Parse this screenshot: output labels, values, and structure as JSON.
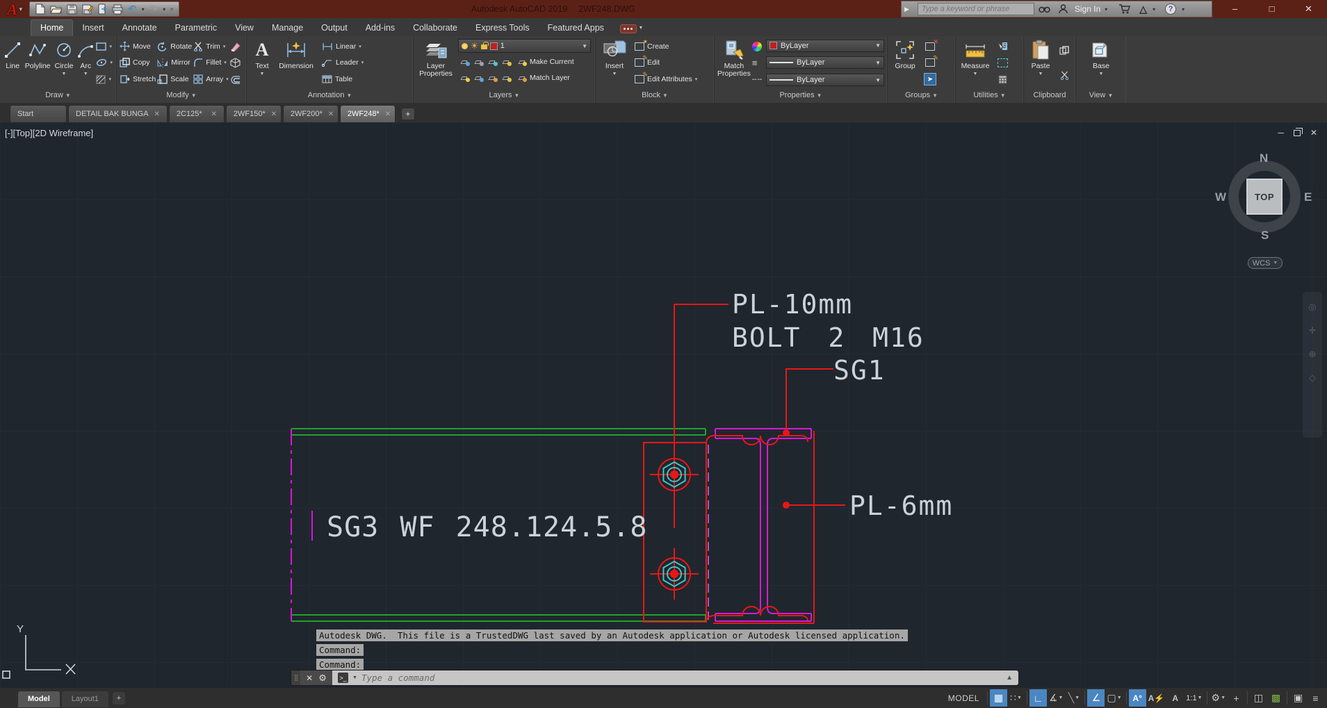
{
  "titlebar": {
    "app_title": "Autodesk AutoCAD 2019",
    "file_title": "2WF248.DWG",
    "search_placeholder": "Type a keyword or phrase",
    "sign_in": "Sign In",
    "qat_icons": [
      "new",
      "open",
      "save",
      "save-as",
      "export",
      "print",
      "undo",
      "redo"
    ]
  },
  "ribbon": {
    "tabs": [
      "Home",
      "Insert",
      "Annotate",
      "Parametric",
      "View",
      "Manage",
      "Output",
      "Add-ins",
      "Collaborate",
      "Express Tools",
      "Featured Apps"
    ],
    "active_tab": "Home",
    "panel_labels": [
      "Draw",
      "Modify",
      "Annotation",
      "Layers",
      "Block",
      "Properties",
      "Groups",
      "Utilities",
      "Clipboard",
      "View"
    ],
    "draw": {
      "line": "Line",
      "polyline": "Polyline",
      "circle": "Circle",
      "arc": "Arc"
    },
    "modify": {
      "move": "Move",
      "copy": "Copy",
      "stretch": "Stretch",
      "rotate": "Rotate",
      "mirror": "Mirror",
      "scale": "Scale",
      "trim": "Trim",
      "fillet": "Fillet",
      "array": "Array"
    },
    "annotation": {
      "text": "Text",
      "dimension": "Dimension",
      "linear": "Linear",
      "leader": "Leader",
      "table": "Table"
    },
    "layers": {
      "layer_properties": "Layer Properties",
      "current_layer": "1",
      "make_current": "Make Current",
      "match_layer": "Match Layer"
    },
    "block": {
      "insert": "Insert",
      "create": "Create",
      "edit": "Edit",
      "edit_attributes": "Edit Attributes"
    },
    "properties": {
      "match_properties": "Match Properties",
      "color": "ByLayer",
      "lineweight": "ByLayer",
      "linetype": "ByLayer"
    },
    "groups": {
      "group": "Group"
    },
    "utilities": {
      "measure": "Measure"
    },
    "clipboard": {
      "paste": "Paste"
    },
    "view": {
      "base": "Base"
    }
  },
  "file_tabs": {
    "items": [
      "Start",
      "DETAIL BAK BUNGA",
      "2C125*",
      "2WF150*",
      "2WF200*",
      "2WF248*"
    ],
    "active": "2WF248*"
  },
  "canvas": {
    "viewport_label": "[-][Top][2D Wireframe]",
    "viewcube": {
      "n": "N",
      "s": "S",
      "e": "E",
      "w": "W",
      "top": "TOP",
      "wcs": "WCS"
    },
    "ucs": {
      "y": "Y"
    },
    "annotations": {
      "pl10": "PL-10mm",
      "bolt": "BOLT 2 M16",
      "sg1": "SG1",
      "pl6": "PL-6mm",
      "beam": "SG3 WF 248.124.5.8"
    },
    "colors": {
      "background": "#20262e",
      "cad_green": "#1fa32a",
      "cad_magenta": "#d818d8",
      "cad_red": "#e81717",
      "cad_cyan": "#3fc6c6",
      "cad_text": "#ccd2d8",
      "hidden_purple": "#9b59d0"
    }
  },
  "command": {
    "history_trust": "Autodesk DWG.  This file is a TrustedDWG last saved by an Autodesk application or Autodesk licensed application.",
    "history_command1": "Command:",
    "history_command2": "Command:",
    "input_placeholder": "Type a command"
  },
  "statusbar": {
    "model_tab": "Model",
    "layout_tab": "Layout1",
    "mode_badge": "MODEL",
    "annotation_scale": "1:1",
    "icons": [
      "grid",
      "snap",
      "ortho",
      "polar",
      "isometric-drafting",
      "object-snap-tracking",
      "object-snap",
      "annotation-visibility",
      "annotation-autoscale",
      "annotation-scale",
      "workspace-gear",
      "customize-plus",
      "isolate-objects",
      "hardware-acceleration",
      "clean-screen",
      "customization-menu"
    ],
    "accent_blue": "#4a87c2"
  }
}
